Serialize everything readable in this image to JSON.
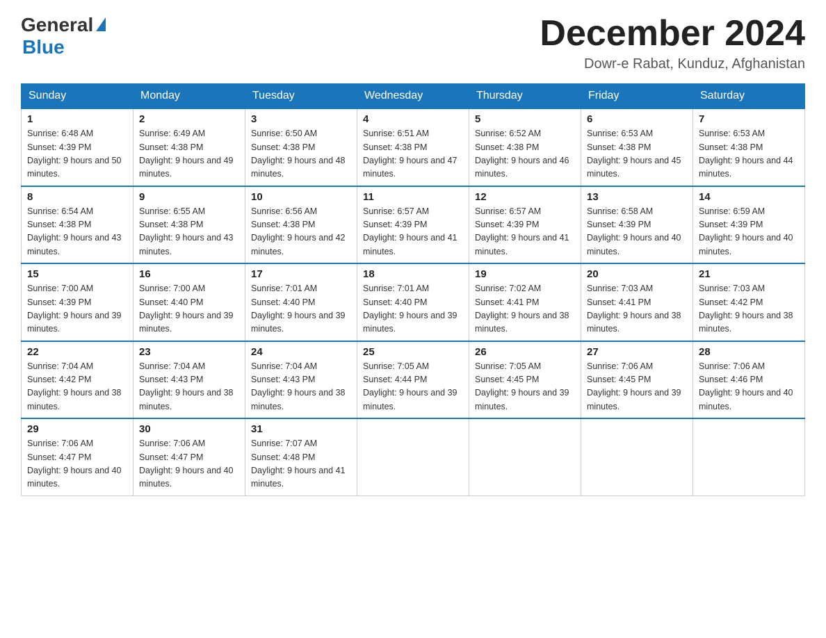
{
  "header": {
    "logo_general": "General",
    "logo_blue": "Blue",
    "month_title": "December 2024",
    "location": "Dowr-e Rabat, Kunduz, Afghanistan"
  },
  "days_of_week": [
    "Sunday",
    "Monday",
    "Tuesday",
    "Wednesday",
    "Thursday",
    "Friday",
    "Saturday"
  ],
  "weeks": [
    [
      {
        "day": "1",
        "sunrise": "6:48 AM",
        "sunset": "4:39 PM",
        "daylight": "9 hours and 50 minutes."
      },
      {
        "day": "2",
        "sunrise": "6:49 AM",
        "sunset": "4:38 PM",
        "daylight": "9 hours and 49 minutes."
      },
      {
        "day": "3",
        "sunrise": "6:50 AM",
        "sunset": "4:38 PM",
        "daylight": "9 hours and 48 minutes."
      },
      {
        "day": "4",
        "sunrise": "6:51 AM",
        "sunset": "4:38 PM",
        "daylight": "9 hours and 47 minutes."
      },
      {
        "day": "5",
        "sunrise": "6:52 AM",
        "sunset": "4:38 PM",
        "daylight": "9 hours and 46 minutes."
      },
      {
        "day": "6",
        "sunrise": "6:53 AM",
        "sunset": "4:38 PM",
        "daylight": "9 hours and 45 minutes."
      },
      {
        "day": "7",
        "sunrise": "6:53 AM",
        "sunset": "4:38 PM",
        "daylight": "9 hours and 44 minutes."
      }
    ],
    [
      {
        "day": "8",
        "sunrise": "6:54 AM",
        "sunset": "4:38 PM",
        "daylight": "9 hours and 43 minutes."
      },
      {
        "day": "9",
        "sunrise": "6:55 AM",
        "sunset": "4:38 PM",
        "daylight": "9 hours and 43 minutes."
      },
      {
        "day": "10",
        "sunrise": "6:56 AM",
        "sunset": "4:38 PM",
        "daylight": "9 hours and 42 minutes."
      },
      {
        "day": "11",
        "sunrise": "6:57 AM",
        "sunset": "4:39 PM",
        "daylight": "9 hours and 41 minutes."
      },
      {
        "day": "12",
        "sunrise": "6:57 AM",
        "sunset": "4:39 PM",
        "daylight": "9 hours and 41 minutes."
      },
      {
        "day": "13",
        "sunrise": "6:58 AM",
        "sunset": "4:39 PM",
        "daylight": "9 hours and 40 minutes."
      },
      {
        "day": "14",
        "sunrise": "6:59 AM",
        "sunset": "4:39 PM",
        "daylight": "9 hours and 40 minutes."
      }
    ],
    [
      {
        "day": "15",
        "sunrise": "7:00 AM",
        "sunset": "4:39 PM",
        "daylight": "9 hours and 39 minutes."
      },
      {
        "day": "16",
        "sunrise": "7:00 AM",
        "sunset": "4:40 PM",
        "daylight": "9 hours and 39 minutes."
      },
      {
        "day": "17",
        "sunrise": "7:01 AM",
        "sunset": "4:40 PM",
        "daylight": "9 hours and 39 minutes."
      },
      {
        "day": "18",
        "sunrise": "7:01 AM",
        "sunset": "4:40 PM",
        "daylight": "9 hours and 39 minutes."
      },
      {
        "day": "19",
        "sunrise": "7:02 AM",
        "sunset": "4:41 PM",
        "daylight": "9 hours and 38 minutes."
      },
      {
        "day": "20",
        "sunrise": "7:03 AM",
        "sunset": "4:41 PM",
        "daylight": "9 hours and 38 minutes."
      },
      {
        "day": "21",
        "sunrise": "7:03 AM",
        "sunset": "4:42 PM",
        "daylight": "9 hours and 38 minutes."
      }
    ],
    [
      {
        "day": "22",
        "sunrise": "7:04 AM",
        "sunset": "4:42 PM",
        "daylight": "9 hours and 38 minutes."
      },
      {
        "day": "23",
        "sunrise": "7:04 AM",
        "sunset": "4:43 PM",
        "daylight": "9 hours and 38 minutes."
      },
      {
        "day": "24",
        "sunrise": "7:04 AM",
        "sunset": "4:43 PM",
        "daylight": "9 hours and 38 minutes."
      },
      {
        "day": "25",
        "sunrise": "7:05 AM",
        "sunset": "4:44 PM",
        "daylight": "9 hours and 39 minutes."
      },
      {
        "day": "26",
        "sunrise": "7:05 AM",
        "sunset": "4:45 PM",
        "daylight": "9 hours and 39 minutes."
      },
      {
        "day": "27",
        "sunrise": "7:06 AM",
        "sunset": "4:45 PM",
        "daylight": "9 hours and 39 minutes."
      },
      {
        "day": "28",
        "sunrise": "7:06 AM",
        "sunset": "4:46 PM",
        "daylight": "9 hours and 40 minutes."
      }
    ],
    [
      {
        "day": "29",
        "sunrise": "7:06 AM",
        "sunset": "4:47 PM",
        "daylight": "9 hours and 40 minutes."
      },
      {
        "day": "30",
        "sunrise": "7:06 AM",
        "sunset": "4:47 PM",
        "daylight": "9 hours and 40 minutes."
      },
      {
        "day": "31",
        "sunrise": "7:07 AM",
        "sunset": "4:48 PM",
        "daylight": "9 hours and 41 minutes."
      },
      null,
      null,
      null,
      null
    ]
  ]
}
